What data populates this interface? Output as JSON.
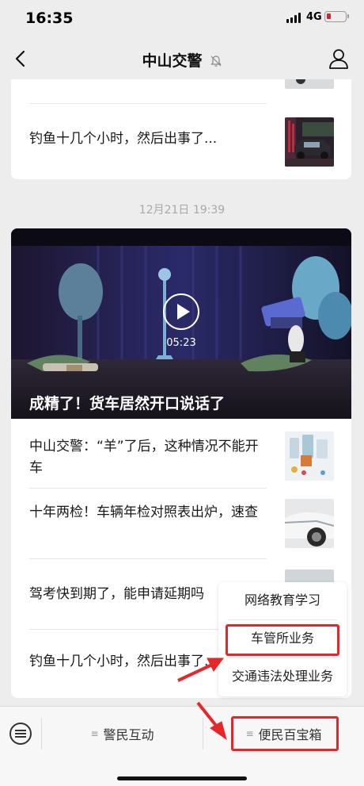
{
  "status_bar": {
    "time": "16:35",
    "network": "4G"
  },
  "navbar": {
    "title": "中山交警",
    "back_icon": "chevron-left-icon",
    "mute_icon": "bell-off-icon",
    "profile_icon": "person-icon"
  },
  "feed": {
    "card1": {
      "items": [
        {
          "title": "钓鱼十几个小时，然后出事了..."
        }
      ]
    },
    "timestamp": "12月21日 19:39",
    "card2": {
      "cover": {
        "duration": "05:23",
        "title": "成精了！货车居然开口说话了"
      },
      "items": [
        {
          "title": "中山交警：“羊”了后，这种情况不能开车"
        },
        {
          "title": "十年两检！车辆年检对照表出炉，速查"
        },
        {
          "title": "驾考快到期了，能申请延期吗"
        },
        {
          "title": "钓鱼十几个小时，然后出事了..."
        }
      ]
    }
  },
  "popup_menu": {
    "items": [
      {
        "label": "网络教育学习"
      },
      {
        "label": "车管所业务"
      },
      {
        "label": "交通违法处理业务"
      }
    ]
  },
  "bottom_menu": {
    "keyboard_icon": "keyboard-icon",
    "items": [
      {
        "label": "警民互动"
      },
      {
        "label": "便民百宝箱"
      }
    ]
  },
  "colors": {
    "annotation_red": "#e5262a",
    "background": "#ededed"
  }
}
